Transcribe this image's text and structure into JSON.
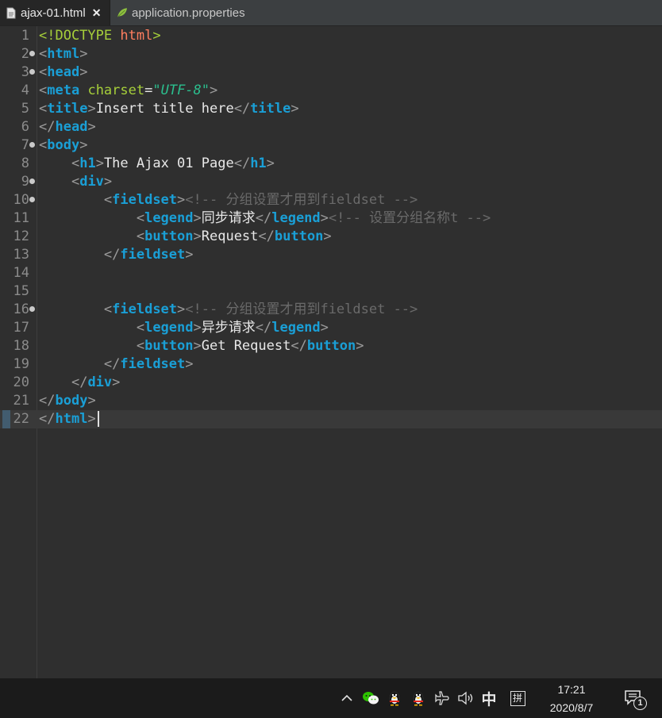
{
  "tabs": [
    {
      "label": "ajax-01.html",
      "active": true,
      "icon": "html-file-icon",
      "close": "✕"
    },
    {
      "label": "application.properties",
      "active": false,
      "icon": "properties-leaf-icon"
    }
  ],
  "editor": {
    "current_line": 22,
    "lines": [
      {
        "num": "1",
        "fold": false,
        "tokens": [
          {
            "t": "dt",
            "v": "<!DOCTYPE"
          },
          {
            "t": "tx",
            "v": " "
          },
          {
            "t": "ky",
            "v": "html"
          },
          {
            "t": "dt",
            "v": ">"
          }
        ]
      },
      {
        "num": "2",
        "fold": true,
        "tokens": [
          {
            "t": "br",
            "v": "<"
          },
          {
            "t": "tg",
            "v": "html"
          },
          {
            "t": "br",
            "v": ">"
          }
        ]
      },
      {
        "num": "3",
        "fold": true,
        "tokens": [
          {
            "t": "br",
            "v": "<"
          },
          {
            "t": "tg",
            "v": "head"
          },
          {
            "t": "br",
            "v": ">"
          }
        ]
      },
      {
        "num": "4",
        "fold": false,
        "tokens": [
          {
            "t": "br",
            "v": "<"
          },
          {
            "t": "tg",
            "v": "meta"
          },
          {
            "t": "tx",
            "v": " "
          },
          {
            "t": "at",
            "v": "charset"
          },
          {
            "t": "tx",
            "v": "="
          },
          {
            "t": "vl",
            "v": "\"UTF-8\""
          },
          {
            "t": "br",
            "v": ">"
          }
        ]
      },
      {
        "num": "5",
        "fold": false,
        "tokens": [
          {
            "t": "br",
            "v": "<"
          },
          {
            "t": "tg",
            "v": "title"
          },
          {
            "t": "br",
            "v": ">"
          },
          {
            "t": "tx",
            "v": "Insert title here"
          },
          {
            "t": "br",
            "v": "</"
          },
          {
            "t": "tg",
            "v": "title"
          },
          {
            "t": "br",
            "v": ">"
          }
        ]
      },
      {
        "num": "6",
        "fold": false,
        "tokens": [
          {
            "t": "br",
            "v": "</"
          },
          {
            "t": "tg",
            "v": "head"
          },
          {
            "t": "br",
            "v": ">"
          }
        ]
      },
      {
        "num": "7",
        "fold": true,
        "tokens": [
          {
            "t": "br",
            "v": "<"
          },
          {
            "t": "tg",
            "v": "body"
          },
          {
            "t": "br",
            "v": ">"
          }
        ]
      },
      {
        "num": "8",
        "fold": false,
        "tokens": [
          {
            "t": "tx",
            "v": "    "
          },
          {
            "t": "br",
            "v": "<"
          },
          {
            "t": "tg",
            "v": "h1"
          },
          {
            "t": "br",
            "v": ">"
          },
          {
            "t": "tx",
            "v": "The Ajax 01 Page"
          },
          {
            "t": "br",
            "v": "</"
          },
          {
            "t": "tg",
            "v": "h1"
          },
          {
            "t": "br",
            "v": ">"
          }
        ]
      },
      {
        "num": "9",
        "fold": true,
        "tokens": [
          {
            "t": "tx",
            "v": "    "
          },
          {
            "t": "br",
            "v": "<"
          },
          {
            "t": "tg",
            "v": "div"
          },
          {
            "t": "br",
            "v": ">"
          }
        ]
      },
      {
        "num": "10",
        "fold": true,
        "tokens": [
          {
            "t": "tx",
            "v": "        "
          },
          {
            "t": "br",
            "v": "<"
          },
          {
            "t": "tg",
            "v": "fieldset"
          },
          {
            "t": "br",
            "v": ">"
          },
          {
            "t": "cm",
            "v": "<!-- 分组设置才用到fieldset -->"
          }
        ]
      },
      {
        "num": "11",
        "fold": false,
        "tokens": [
          {
            "t": "tx",
            "v": "            "
          },
          {
            "t": "br",
            "v": "<"
          },
          {
            "t": "tg",
            "v": "legend"
          },
          {
            "t": "br",
            "v": ">"
          },
          {
            "t": "tx",
            "v": "同步请求"
          },
          {
            "t": "br",
            "v": "</"
          },
          {
            "t": "tg",
            "v": "legend"
          },
          {
            "t": "br",
            "v": ">"
          },
          {
            "t": "cm",
            "v": "<!-- 设置分组名称t -->"
          }
        ]
      },
      {
        "num": "12",
        "fold": false,
        "tokens": [
          {
            "t": "tx",
            "v": "            "
          },
          {
            "t": "br",
            "v": "<"
          },
          {
            "t": "tg",
            "v": "button"
          },
          {
            "t": "br",
            "v": ">"
          },
          {
            "t": "tx",
            "v": "Request"
          },
          {
            "t": "br",
            "v": "</"
          },
          {
            "t": "tg",
            "v": "button"
          },
          {
            "t": "br",
            "v": ">"
          }
        ]
      },
      {
        "num": "13",
        "fold": false,
        "tokens": [
          {
            "t": "tx",
            "v": "        "
          },
          {
            "t": "br",
            "v": "</"
          },
          {
            "t": "tg",
            "v": "fieldset"
          },
          {
            "t": "br",
            "v": ">"
          }
        ]
      },
      {
        "num": "14",
        "fold": false,
        "tokens": []
      },
      {
        "num": "15",
        "fold": false,
        "tokens": []
      },
      {
        "num": "16",
        "fold": true,
        "tokens": [
          {
            "t": "tx",
            "v": "        "
          },
          {
            "t": "br",
            "v": "<"
          },
          {
            "t": "tg",
            "v": "fieldset"
          },
          {
            "t": "br",
            "v": ">"
          },
          {
            "t": "cm",
            "v": "<!-- 分组设置才用到fieldset -->"
          }
        ]
      },
      {
        "num": "17",
        "fold": false,
        "tokens": [
          {
            "t": "tx",
            "v": "            "
          },
          {
            "t": "br",
            "v": "<"
          },
          {
            "t": "tg",
            "v": "legend"
          },
          {
            "t": "br",
            "v": ">"
          },
          {
            "t": "tx",
            "v": "异步请求"
          },
          {
            "t": "br",
            "v": "</"
          },
          {
            "t": "tg",
            "v": "legend"
          },
          {
            "t": "br",
            "v": ">"
          }
        ]
      },
      {
        "num": "18",
        "fold": false,
        "tokens": [
          {
            "t": "tx",
            "v": "            "
          },
          {
            "t": "br",
            "v": "<"
          },
          {
            "t": "tg",
            "v": "button"
          },
          {
            "t": "br",
            "v": ">"
          },
          {
            "t": "tx",
            "v": "Get Request"
          },
          {
            "t": "br",
            "v": "</"
          },
          {
            "t": "tg",
            "v": "button"
          },
          {
            "t": "br",
            "v": ">"
          }
        ]
      },
      {
        "num": "19",
        "fold": false,
        "tokens": [
          {
            "t": "tx",
            "v": "        "
          },
          {
            "t": "br",
            "v": "</"
          },
          {
            "t": "tg",
            "v": "fieldset"
          },
          {
            "t": "br",
            "v": ">"
          }
        ]
      },
      {
        "num": "20",
        "fold": false,
        "tokens": [
          {
            "t": "tx",
            "v": "    "
          },
          {
            "t": "br",
            "v": "</"
          },
          {
            "t": "tg",
            "v": "div"
          },
          {
            "t": "br",
            "v": ">"
          }
        ]
      },
      {
        "num": "21",
        "fold": false,
        "tokens": [
          {
            "t": "br",
            "v": "</"
          },
          {
            "t": "tg",
            "v": "body"
          },
          {
            "t": "br",
            "v": ">"
          }
        ]
      },
      {
        "num": "22",
        "fold": false,
        "tokens": [
          {
            "t": "br",
            "v": "</"
          },
          {
            "t": "tg",
            "v": "html"
          },
          {
            "t": "br",
            "v": ">"
          }
        ]
      }
    ]
  },
  "taskbar": {
    "tray_items": [
      {
        "name": "show-hidden-icons-chevron-icon",
        "glyph": "^"
      },
      {
        "name": "wechat-icon",
        "glyph": ""
      },
      {
        "name": "qq-penguin-icon",
        "glyph": ""
      },
      {
        "name": "qq-penguin-icon-2",
        "glyph": ""
      },
      {
        "name": "airplane-mode-icon",
        "glyph": "✈"
      },
      {
        "name": "volume-icon",
        "glyph": "🔈"
      }
    ],
    "ime_mode": "中",
    "ime_layout": "拼",
    "time": "17:21",
    "date": "2020/8/7",
    "notification_count": "1"
  }
}
